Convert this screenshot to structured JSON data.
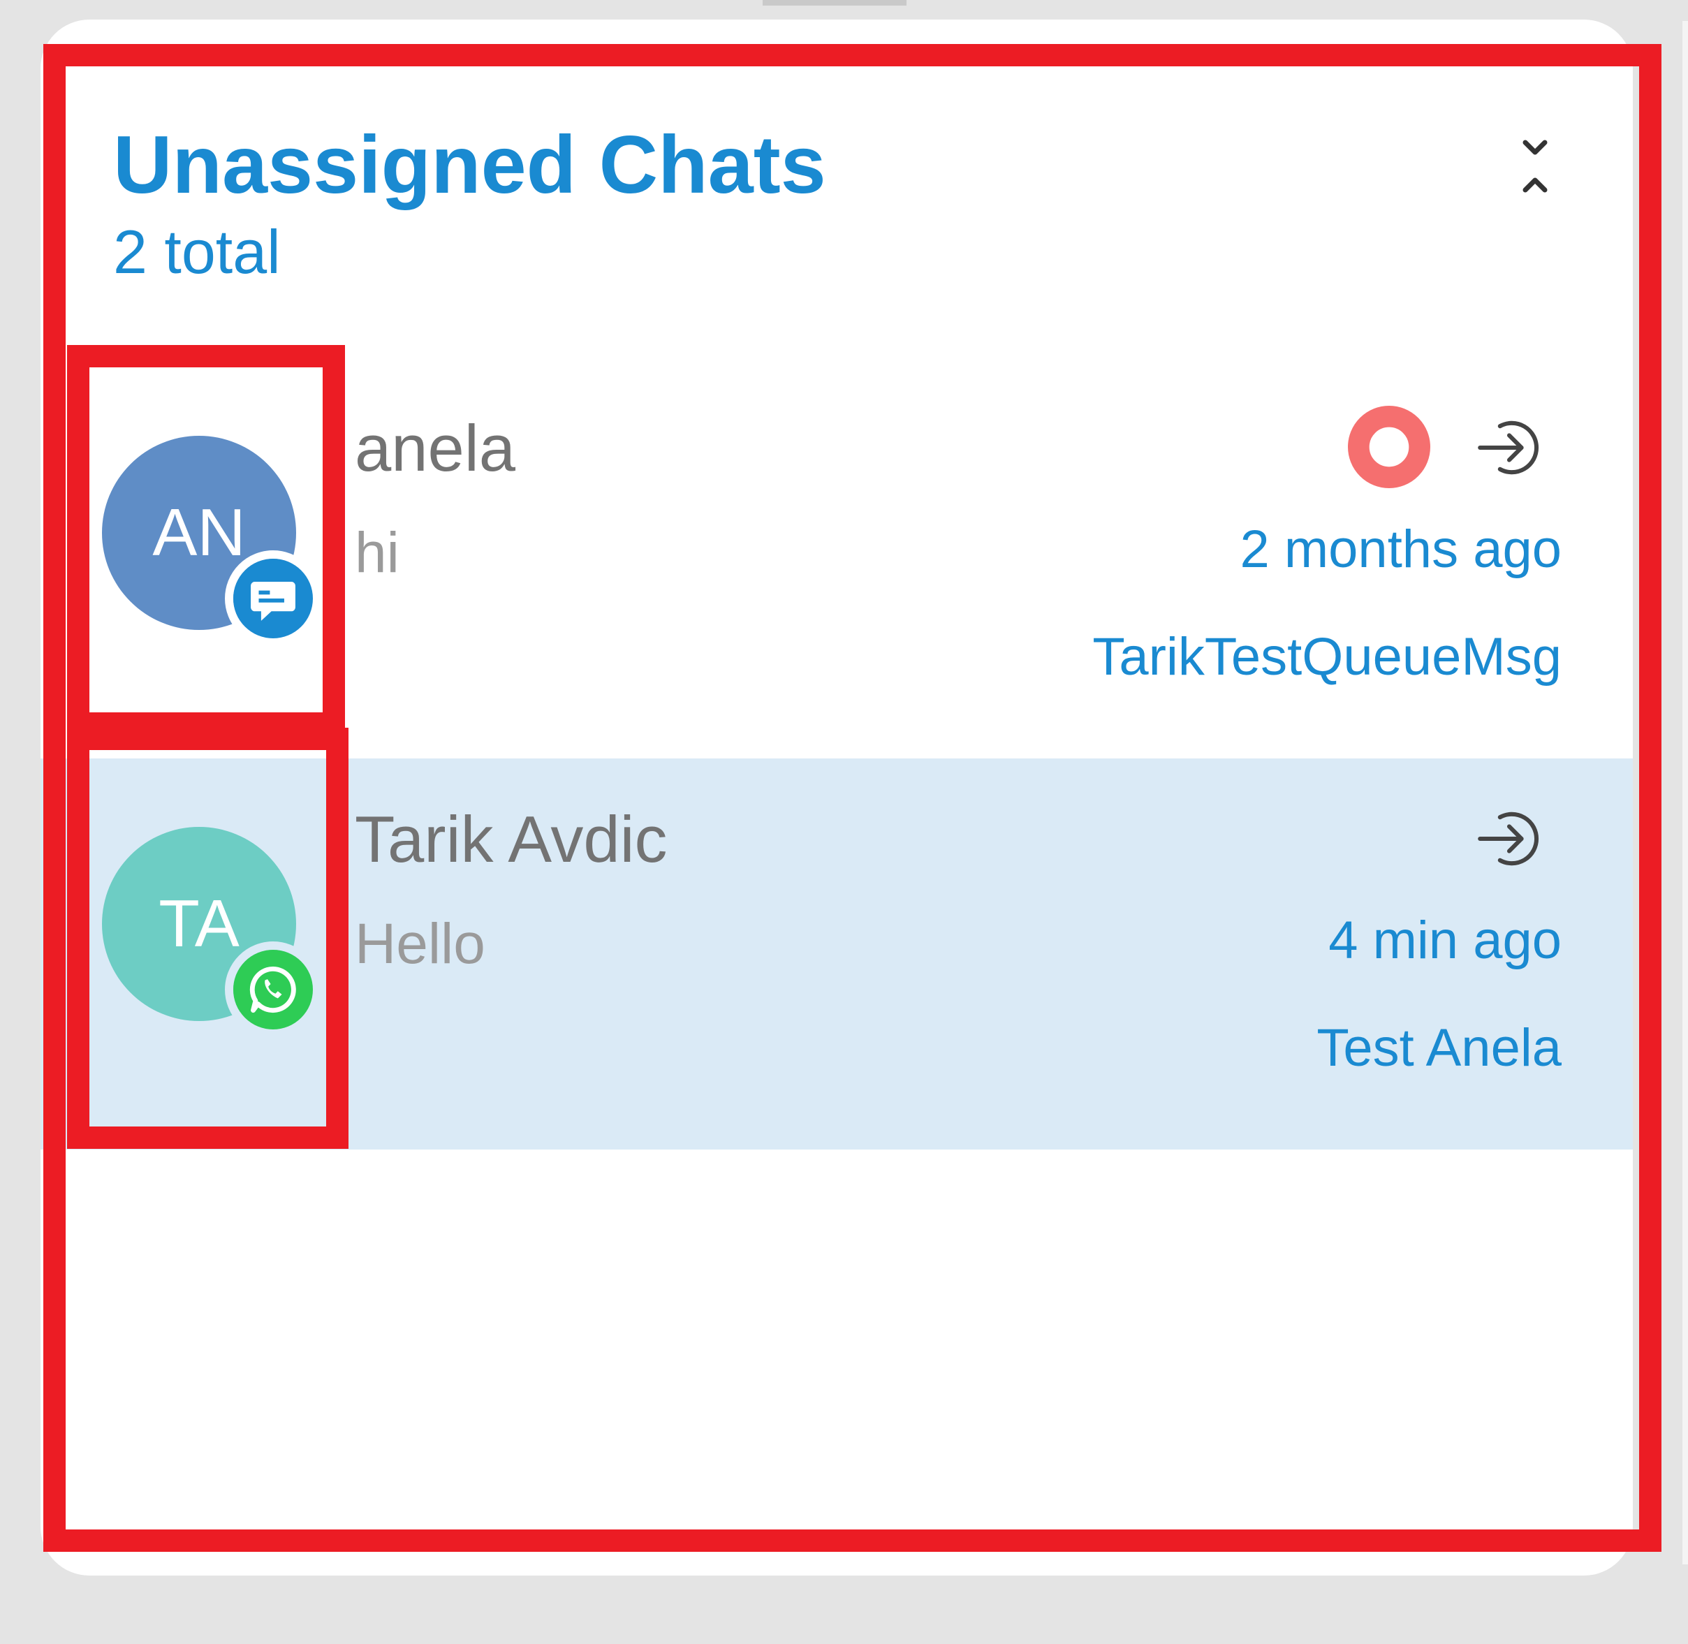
{
  "panel": {
    "title": "Unassigned Chats",
    "total_label": "2 total",
    "collapse_icon": "collapse-chevrons-icon"
  },
  "chats": [
    {
      "initials": "AN",
      "name": "anela",
      "message": "hi",
      "time": "2 months ago",
      "queue": "TarikTestQueueMsg",
      "avatar_color": "#5f8dc6",
      "channel": "chat-bubble-icon",
      "channel_color": "#1a8ad1",
      "unread_indicator": true,
      "unread_color": "#f56f6f",
      "selected": false
    },
    {
      "initials": "TA",
      "name": "Tarik Avdic",
      "message": "Hello",
      "time": "4 min ago",
      "queue": "Test Anela",
      "avatar_color": "#6dcdc4",
      "channel": "whatsapp-icon",
      "channel_color": "#2ecc55",
      "unread_indicator": false,
      "selected": true
    }
  ],
  "annotations": {
    "color": "#ec1c24"
  }
}
